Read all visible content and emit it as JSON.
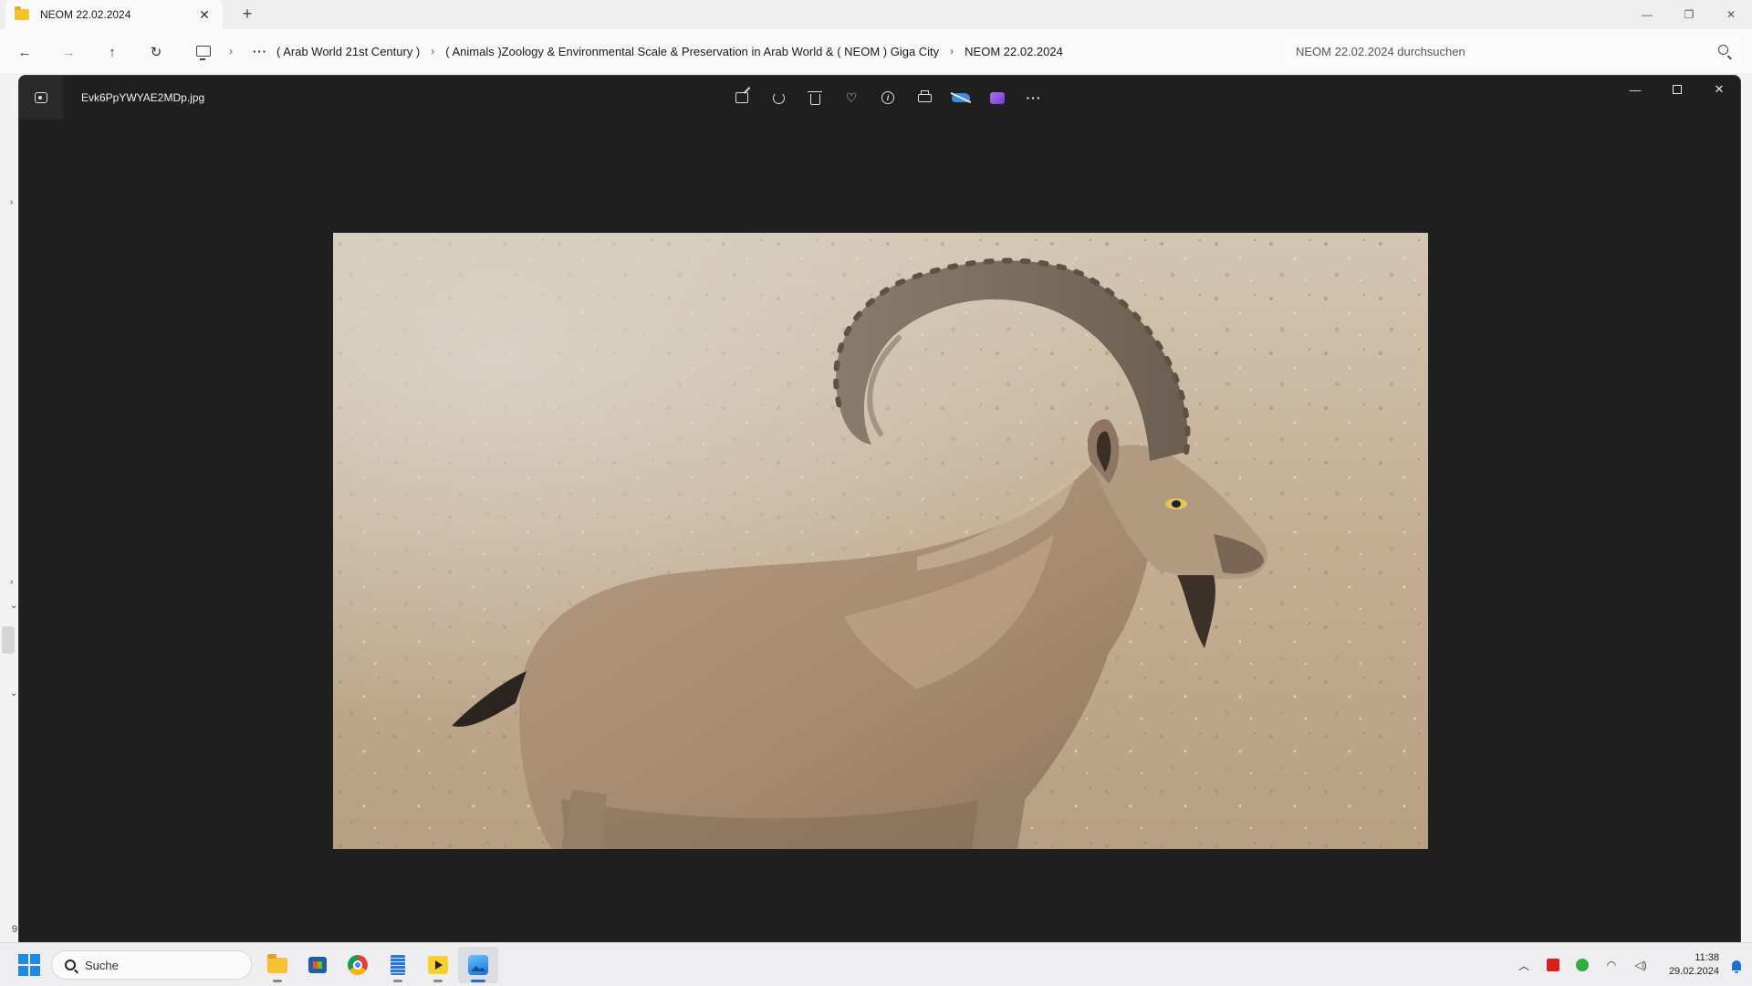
{
  "explorer": {
    "tab_title": "NEOM 22.02.2024",
    "tab_close": "✕",
    "new_tab": "+",
    "window_controls": {
      "minimize": "—",
      "restore": "❐",
      "close": "✕"
    },
    "nav": {
      "back": "←",
      "forward": "→",
      "up": "↑",
      "refresh": "↻"
    },
    "breadcrumb": {
      "overflow": "···",
      "separator": "›",
      "items": [
        "( Arab World 21st Century )",
        "( Animals )Zoology & Environmental Scale & Preservation in Arab World  & ( NEOM ) Giga City",
        "NEOM 22.02.2024"
      ]
    },
    "search_placeholder": "NEOM 22.02.2024 durchsuchen",
    "left_pane": {
      "chevron_right": "›",
      "chevron_down": "⌄",
      "count_fragment": "9"
    }
  },
  "photos_app": {
    "file_name": "Evk6PpYWYAE2MDp.jpg",
    "toolbar": {
      "edit": "edit-image-icon",
      "rotate": "rotate-icon",
      "delete": "trash-icon",
      "favorite": "♡",
      "info": "i",
      "print": "print-icon",
      "onedrive": "onedrive-icon",
      "clipchamp": "clipchamp-icon",
      "more": "···"
    },
    "window_controls": {
      "minimize": "—",
      "close": "✕"
    }
  },
  "taskbar": {
    "search_label": "Suche",
    "apps": [
      "file-explorer",
      "microsoft-store",
      "chrome",
      "notepad",
      "media-player",
      "photos"
    ],
    "tray": {
      "chevron": "︿",
      "wifi": "wifi-icon",
      "volume": "volume-icon"
    },
    "time": "11:38",
    "date": "29.02.2024"
  },
  "colors": {
    "photos_bg": "#1f1f1f",
    "accent": "#1f6fd1",
    "sand": "#c9b49a"
  }
}
